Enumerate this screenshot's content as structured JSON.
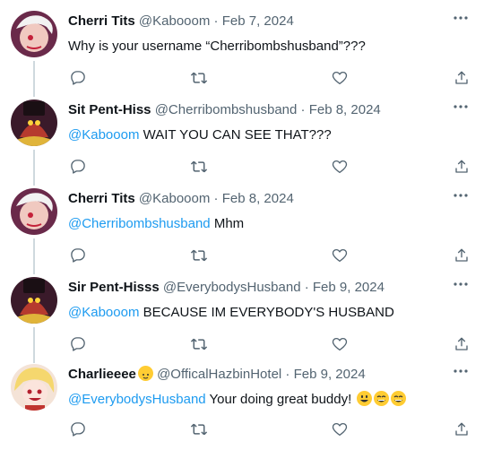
{
  "tweets": [
    {
      "name": "Cherri Tits",
      "handle": "@Kabooom",
      "dot": "·",
      "date": "Feb 7, 2024",
      "text": "Why is your username “Cherribombshusband”???",
      "avatar": "cherri-avatar"
    },
    {
      "name": "Sit Pent-Hiss",
      "handle": "@Cherribombshusband",
      "dot": "·",
      "date": "Feb 8, 2024",
      "mention": "@Kabooom",
      "text": " WAIT YOU CAN SEE THAT???",
      "avatar": "pentious-avatar"
    },
    {
      "name": "Cherri Tits",
      "handle": "@Kabooom",
      "dot": "·",
      "date": "Feb 8, 2024",
      "mention": "@Cherribombshusband",
      "text": " Mhm",
      "avatar": "cherri-avatar"
    },
    {
      "name": "Sir Pent-Hisss",
      "handle": "@EverybodysHusband",
      "dot": "·",
      "date": "Feb 9, 2024",
      "mention": "@Kabooom",
      "text": " BECAUSE IM EVERYBODY'S HUSBAND",
      "avatar": "pentious-avatar"
    },
    {
      "name": "Charlieeee",
      "handle": "@OfficalHazbinHotel",
      "dot": "·",
      "date": "Feb 9, 2024",
      "mention": "@EverybodysHusband",
      "text": " Your doing great buddy!",
      "avatar": "charlie-avatar",
      "name_emoji": "smiling-cat-face-emoji",
      "text_emojis": [
        "grinning-face-emoji",
        "grinning-squinting-face-emoji",
        "grinning-squinting-face-emoji"
      ]
    }
  ],
  "icons": {
    "more": "more-horizontal-icon",
    "reply": "reply-icon",
    "retweet": "retweet-icon",
    "like": "like-heart-icon",
    "share": "share-icon"
  },
  "colors": {
    "name": "#0f1419",
    "secondary": "#536471",
    "mention": "#1d9bf0",
    "thread_line": "#cfd9de"
  }
}
